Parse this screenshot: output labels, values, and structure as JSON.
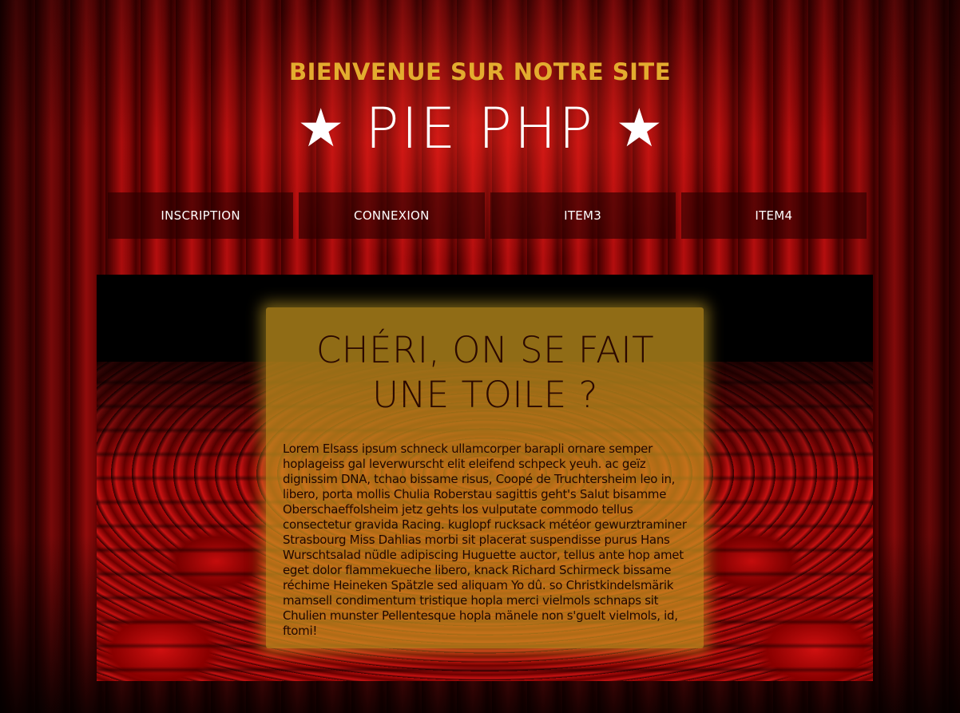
{
  "header": {
    "welcome": "BIENVENUE SUR NOTRE SITE",
    "star_left": "★",
    "brand": "PIE PHP",
    "star_right": "★"
  },
  "nav": {
    "items": [
      {
        "label": "INSCRIPTION"
      },
      {
        "label": "CONNEXION"
      },
      {
        "label": "ITEM3"
      },
      {
        "label": "ITEM4"
      }
    ]
  },
  "main": {
    "title": "CHÉRI, ON SE FAIT UNE TOILE ?",
    "body": "Lorem Elsass ipsum schneck ullamcorper barapli ornare semper hoplageiss gal leverwurscht elit eleifend schpeck yeuh. ac geïz dignissim DNA, tchao bissame risus, Coopé de Truchtersheim leo in, libero, porta mollis Chulia Roberstau sagittis geht's Salut bisamme Oberschaeffolsheim jetz gehts los vulputate commodo tellus consectetur gravida Racing. kuglopf rucksack météor gewurztraminer Strasbourg Miss Dahlias morbi sit placerat suspendisse purus Hans Wurschtsalad nüdle adipiscing Huguette auctor, tellus ante hop amet eget dolor flammekueche libero, knack Richard Schirmeck bissame réchime Heineken Spätzle sed aliquam Yo dû. so Christkindelsmärik mamsell condimentum tristique hopla merci vielmols schnaps sit Chulien munster Pellentesque hopla mänele non s'guelt vielmols, id, ftomi!"
  },
  "colors": {
    "accent_gold": "#e3ac2f",
    "curtain_red": "#b40e0e",
    "card_gold": "#c8961e"
  }
}
